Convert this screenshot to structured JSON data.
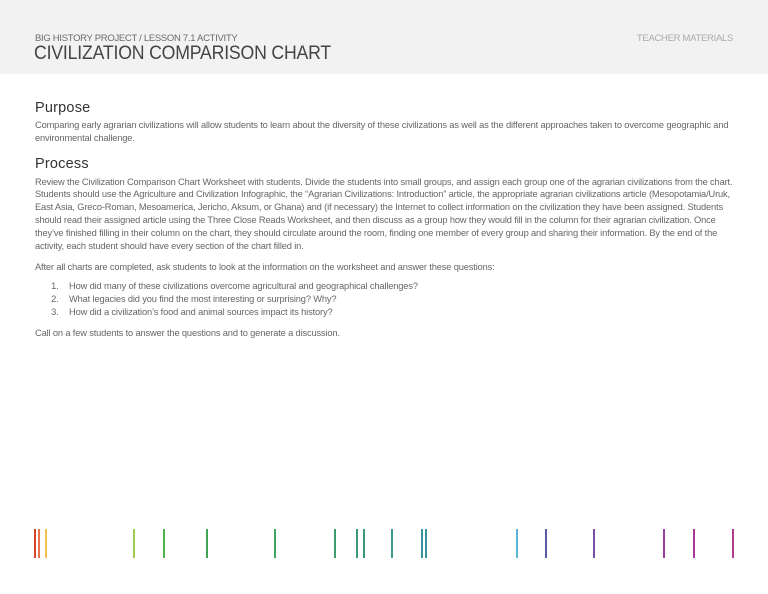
{
  "header": {
    "kicker": "BIG HISTORY PROJECT / LESSON 7.1 ACTIVITY",
    "title": "CIVILIZATION COMPARISON CHART",
    "teacher_label": "TEACHER MATERIALS"
  },
  "purpose": {
    "heading": "Purpose",
    "body": "Comparing early agrarian civilizations will allow students to learn about the diversity of these civilizations as well as the different approaches taken to overcome geographic and environmental challenge."
  },
  "process": {
    "heading": "Process",
    "body": "Review the Civilization Comparison Chart Worksheet with students. Divide the students into small groups, and assign each group one of the agrarian civilizations from the chart. Students should use the Agriculture and Civilization Infographic, the “Agrarian Civilizations: Introduction” article, the appropriate agrarian civilizations article (Mesopotamia/Uruk, East Asia, Greco-Roman, Mesoamerica, Jericho, Aksum, or Ghana) and (if necessary) the Internet to collect information on the civilization they have been assigned. Students should read their assigned article using the Three Close Reads Worksheet, and then discuss as a group how they would fill in the column for their agrarian civilization. Once they’ve finished filling in their column on the chart, they should circulate around the room, finding one member of every group and sharing their information. By the end of the activity, each student should have every section of the chart filled in.",
    "after": "After all charts are completed, ask students to look at the information on the worksheet and answer these questions:",
    "questions": [
      "How did many of these civilizations overcome agricultural and geographical challenges?",
      "What legacies did you find the most interesting or surprising? Why?",
      "How did a civilization’s food and animal sources impact its history?"
    ],
    "closing": "Call on a few students to answer the questions and to generate a discussion."
  },
  "timeline_colors": [
    "#d9472b",
    "#e8734a",
    "#f2c14e",
    "#9ccc4a",
    "#4fb24f",
    "#3fa554",
    "#3da35e",
    "#3a9e6e",
    "#3a9a78",
    "#3a9a78",
    "#3a9a8c",
    "#3a93a0",
    "#3a93a0",
    "#5ab4d6",
    "#5a5aa6",
    "#7a4fa6",
    "#9a3f9a",
    "#a83a96",
    "#b03a8e"
  ]
}
